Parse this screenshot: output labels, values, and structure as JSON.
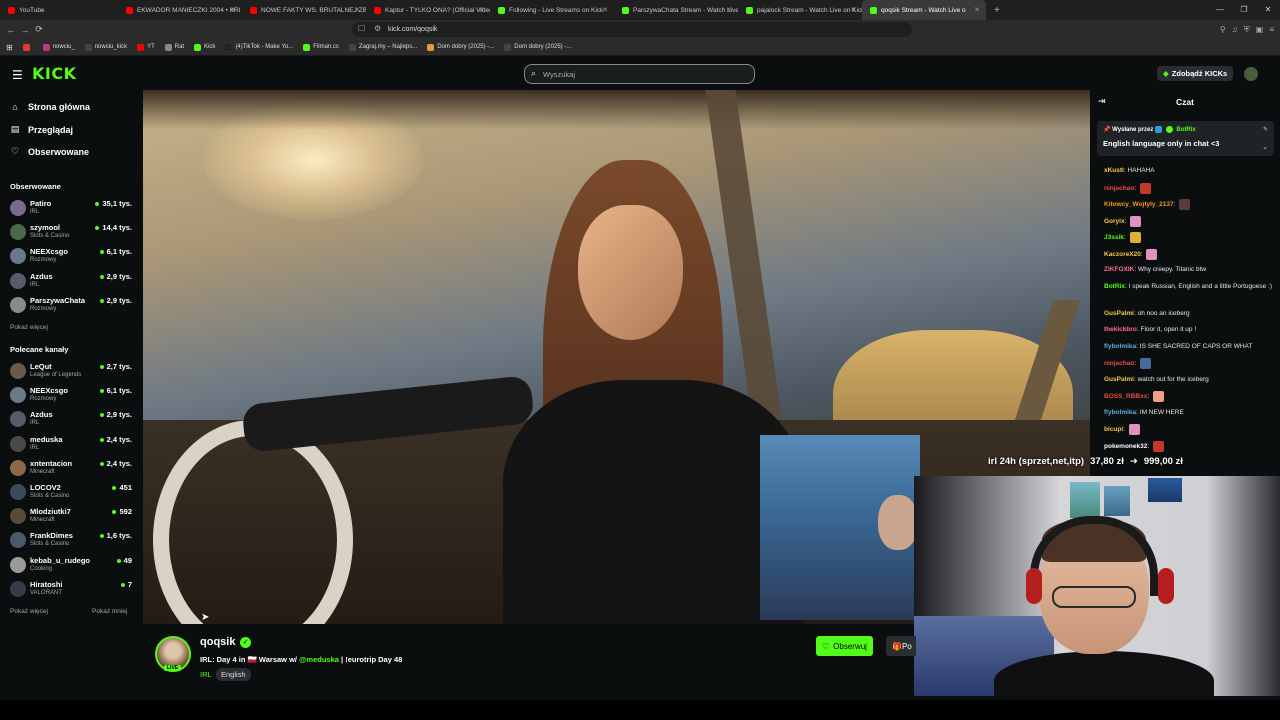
{
  "browser": {
    "tabs": [
      {
        "title": "YouTube",
        "color": "#ff0000"
      },
      {
        "title": "EKWADOR MANIECZKI 2004 • KRI",
        "color": "#ff0000"
      },
      {
        "title": "NOWE FAKTY WS. BRUTALNEJ ZBRO",
        "color": "#ff0000"
      },
      {
        "title": "Kaptur - TYLKO ONA? (Official Video",
        "color": "#ff0000"
      },
      {
        "title": "Following - Live Streams on Kick",
        "color": "#53fc18"
      },
      {
        "title": "ParszywaChata Stream - Watch Live",
        "color": "#53fc18"
      },
      {
        "title": "pajalock Stream - Watch Live on Kick",
        "color": "#53fc18"
      },
      {
        "title": "qoqsik Stream - Watch Live o",
        "color": "#53fc18"
      }
    ],
    "url": "kick.com/qoqsik",
    "bookmarks": [
      {
        "label": "",
        "color": "#e53935"
      },
      {
        "label": "nowciu_",
        "color": "#c13584"
      },
      {
        "label": "nowciu_kick",
        "color": "#444"
      },
      {
        "label": "YT",
        "color": "#ff0000"
      },
      {
        "label": "Rat",
        "color": "#888"
      },
      {
        "label": "Kick",
        "color": "#53fc18"
      },
      {
        "label": "(4)TikTok - Make Yo...",
        "color": "#222"
      },
      {
        "label": "Filman.cc",
        "color": "#53fc18"
      },
      {
        "label": "Zagraj.my – Najleps...",
        "color": "#444"
      },
      {
        "label": "Dom dobry (2025) -...",
        "color": "#e0a030"
      },
      {
        "label": "Dom dobry (2025) -...",
        "color": "#444"
      }
    ]
  },
  "header": {
    "logo": "KICK",
    "search_placeholder": "Wyszukaj",
    "kicks_button": "Zdobądź KICKs"
  },
  "sidebar": {
    "nav": [
      "Strona główna",
      "Przeglądaj",
      "Obserwowane"
    ],
    "followed_title": "Obserwowane",
    "followed": [
      {
        "name": "Patiro",
        "category": "IRL",
        "viewers": "35,1 tys.",
        "color": "#7a6a8a"
      },
      {
        "name": "szymool",
        "category": "Slots & Casino",
        "viewers": "14,4 tys.",
        "color": "#4a6a4a"
      },
      {
        "name": "NEEXcsgo",
        "category": "Rozmowy",
        "viewers": "6,1 tys.",
        "color": "#6a7a8a"
      },
      {
        "name": "Azdus",
        "category": "IRL",
        "viewers": "2,9 tys.",
        "color": "#5a5a6a"
      },
      {
        "name": "ParszywaChata",
        "category": "Rozmowy",
        "viewers": "2,9 tys.",
        "color": "#8a8a8a"
      }
    ],
    "show_more_1": "Pokaż więcej",
    "recommended_title": "Polecane kanały",
    "recommended": [
      {
        "name": "LeQut",
        "category": "League of Legends",
        "viewers": "2,7 tys.",
        "color": "#6a5a4a"
      },
      {
        "name": "NEEXcsgo",
        "category": "Rozmowy",
        "viewers": "6,1 tys.",
        "color": "#6a7a8a"
      },
      {
        "name": "Azdus",
        "category": "IRL",
        "viewers": "2,9 tys.",
        "color": "#5a5a6a"
      },
      {
        "name": "meduska",
        "category": "IRL",
        "viewers": "2,4 tys.",
        "color": "#4a4a4a"
      },
      {
        "name": "xntentacion",
        "category": "Minecraft",
        "viewers": "2,4 tys.",
        "color": "#8a6a4a"
      },
      {
        "name": "LOCOV2",
        "category": "Slots & Casino",
        "viewers": "451",
        "color": "#3a4a5a"
      },
      {
        "name": "Mlodziutki7",
        "category": "Minecraft",
        "viewers": "592",
        "color": "#5a4a3a"
      },
      {
        "name": "FrankDimes",
        "category": "Slots & Casino",
        "viewers": "1,6 tys.",
        "color": "#4a5a6a"
      },
      {
        "name": "kebab_u_rudego",
        "category": "Cooking",
        "viewers": "49",
        "color": "#9a9a9a"
      },
      {
        "name": "Hiratoshi",
        "category": "VALORANT",
        "viewers": "7",
        "color": "#3a3a4a"
      }
    ],
    "show_more_2": "Pokaż więcej",
    "show_less": "Pokaż mniej"
  },
  "chat": {
    "title": "Czat",
    "pinned_by_prefix": "Wysłane przez",
    "pinned_by": "BotRix",
    "pinned_text": "English language only in chat <3",
    "messages": [
      {
        "user": "xKustl",
        "color": "#f2c94c",
        "text": "HAHAHA",
        "emote": ""
      },
      {
        "user": "ninjachao",
        "color": "#e74c3c",
        "text": "",
        "emote": "#c0392b"
      },
      {
        "user": "Kitowcy_Wojtyly_2137",
        "color": "#f39c12",
        "text": "",
        "emote": "#5a3a3a"
      },
      {
        "user": "Gorylx",
        "color": "#f2c94c",
        "text": "",
        "emote": "#e091c0"
      },
      {
        "user": "J3ssik",
        "color": "#53fc18",
        "text": "",
        "emote": "#e0b030"
      },
      {
        "user": "KaczoreX20",
        "color": "#f2c94c",
        "text": "",
        "emote": "#e091c0"
      },
      {
        "user": "ZIKFOXIK",
        "color": "#ff6b9a",
        "text": "Why creepy. Titanic btw",
        "emote": ""
      },
      {
        "user": "BotRix",
        "color": "#53fc18",
        "text": "I speak Russian, English and a little Portuguese :)",
        "emote": ""
      },
      {
        "user": "GusPalmi",
        "color": "#f2c94c",
        "text": "oh noo an iceberg",
        "emote": ""
      },
      {
        "user": "thekickbro",
        "color": "#ff6b9a",
        "text": "Floor it, open it up !",
        "emote": ""
      },
      {
        "user": "flybolmika",
        "color": "#5dade2",
        "text": "IS SHE SACRED OF CAPS OR WHAT",
        "emote": ""
      },
      {
        "user": "ninjachao",
        "color": "#e74c3c",
        "text": "",
        "emote": "#4a6a9a"
      },
      {
        "user": "GusPalmi",
        "color": "#f2c94c",
        "text": "watch out for the iceberg",
        "emote": ""
      },
      {
        "user": "BOSS_RBBxx",
        "color": "#e74c3c",
        "text": "",
        "emote": "#f0a080"
      },
      {
        "user": "flybolmika",
        "color": "#5dade2",
        "text": "IM NEW HERE",
        "emote": ""
      },
      {
        "user": "bicupi",
        "color": "#f2c94c",
        "text": "",
        "emote": "#e091c0"
      },
      {
        "user": "pokemonek32",
        "color": "#ffffff",
        "text": "",
        "emote": "#c0392b"
      }
    ]
  },
  "donation": {
    "label": "irl 24h (sprzet,net,itp)",
    "current": "37,80 zł",
    "goal": "999,00 zł"
  },
  "stream": {
    "streamer": "qoqsik",
    "live_badge": "LIVE",
    "title_prefix": "IRL: Day 4 in 🇵🇱 Warsaw w/",
    "title_mention": "@meduska",
    "title_suffix": "| !eurotrip Day 48",
    "category": "IRL",
    "language": "English",
    "follow_button": "Obserwuj",
    "gift_button": "Po"
  }
}
